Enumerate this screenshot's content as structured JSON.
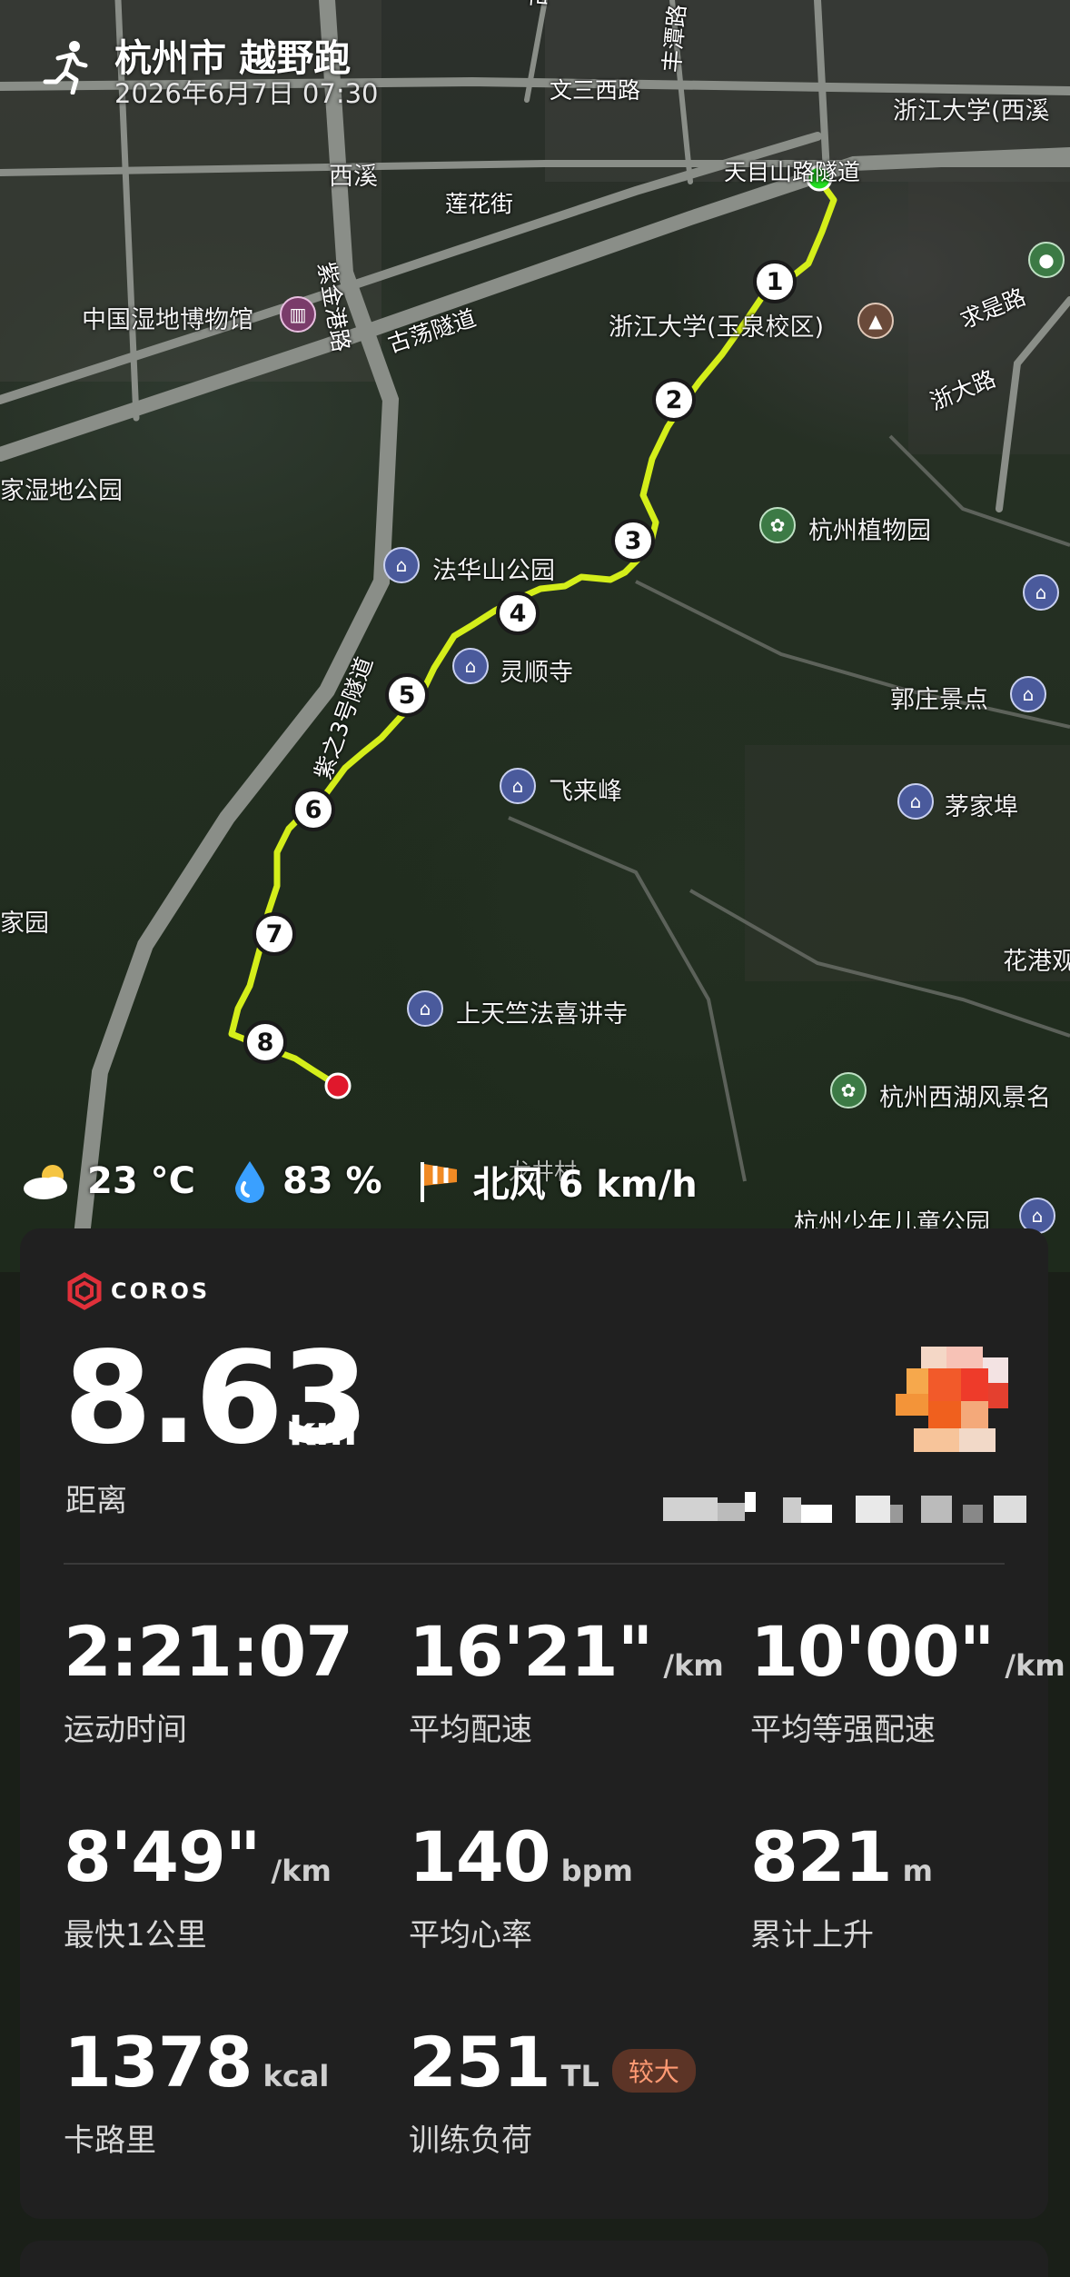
{
  "header": {
    "title": "杭州市 越野跑",
    "datetime": "2026年6月7日 07:30"
  },
  "map": {
    "road_labels": [
      "文三西路",
      "天目山路隧道",
      "莲花街",
      "紫金港路",
      "古荡隧道",
      "求是路",
      "浙大路",
      "紫之3号隧道",
      "古墩路",
      "丰潭路",
      "龙井村"
    ],
    "place_labels": [
      "西溪",
      "浙江大学(西溪",
      "中国湿地博物馆",
      "浙江大学(玉泉校区)",
      "家湿地公园",
      "法华山公园",
      "杭州植物园",
      "灵顺寺",
      "郭庄景点",
      "飞来峰",
      "茅家埠",
      "家园",
      "花港观",
      "上天竺法喜讲寺",
      "杭州西湖风景名",
      "杭州少年儿童公园"
    ],
    "km_markers": [
      "1",
      "2",
      "3",
      "4",
      "5",
      "6",
      "7",
      "8"
    ],
    "route_color": "#d4ee1a",
    "start_color": "#22dd22",
    "end_color": "#e0182c"
  },
  "weather": {
    "temperature": "23 °C",
    "humidity": "83 %",
    "wind": "北风 6 km/h"
  },
  "card": {
    "brand": "COROS",
    "distance": {
      "value": "8.63",
      "unit": "km",
      "label": "距离"
    },
    "stats": [
      {
        "value": "2:21:07",
        "unit": "",
        "label": "运动时间"
      },
      {
        "value": "16'21\"",
        "unit": "/km",
        "label": "平均配速"
      },
      {
        "value": "10'00\"",
        "unit": "/km",
        "label": "平均等强配速"
      },
      {
        "value": "8'49\"",
        "unit": "/km",
        "label": "最快1公里"
      },
      {
        "value": "140",
        "unit": "bpm",
        "label": "平均心率"
      },
      {
        "value": "821",
        "unit": "m",
        "label": "累计上升"
      },
      {
        "value": "1378",
        "unit": "kcal",
        "label": "卡路里"
      },
      {
        "value": "251",
        "unit": "TL",
        "label": "训练负荷",
        "badge": "较大"
      }
    ]
  }
}
